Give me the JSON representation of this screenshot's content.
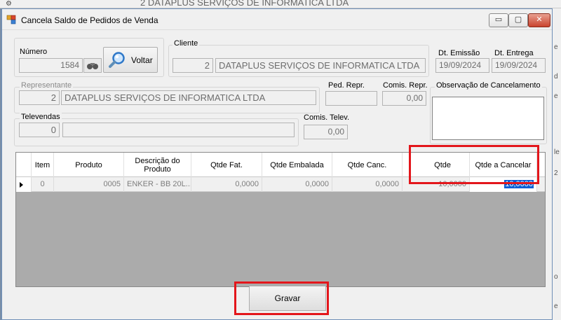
{
  "background": {
    "parent_text": "2  DATAPLUS SERVIÇOS DE INFORMATICA LTDA",
    "right_edge": [
      "e",
      "d",
      "e",
      "le",
      "2",
      "o",
      "e"
    ]
  },
  "window": {
    "title": "Cancela Saldo de Pedidos de Venda",
    "controls": {
      "minimize": "▭",
      "maximize": "▢",
      "close": "✕"
    }
  },
  "form": {
    "numero": {
      "label": "Número",
      "value": "1584"
    },
    "voltar_label": "Voltar",
    "cliente": {
      "label": "Cliente",
      "code": "2",
      "name": "DATAPLUS SERVIÇOS DE INFORMATICA LTDA"
    },
    "dt_emissao": {
      "label": "Dt. Emissão",
      "value": "19/09/2024"
    },
    "dt_entrega": {
      "label": "Dt. Entrega",
      "value": "19/09/2024"
    },
    "representante": {
      "label": "Representante",
      "code": "2",
      "name": "DATAPLUS SERVIÇOS DE INFORMATICA LTDA"
    },
    "ped_repr": {
      "label": "Ped. Repr.",
      "value": ""
    },
    "comis_repr": {
      "label": "Comis. Repr.",
      "value": "0,00"
    },
    "observacao": {
      "label": "Observação de Cancelamento",
      "value": ""
    },
    "televendas": {
      "label": "Televendas",
      "code": "0",
      "name": ""
    },
    "comis_telev": {
      "label": "Comis. Telev.",
      "value": "0,00"
    }
  },
  "grid": {
    "columns": [
      "Item",
      "Produto",
      "Descrição do Produto",
      "Qtde Fat.",
      "Qtde Embalada",
      "Qtde Canc.",
      "Qtde",
      "Qtde a Cancelar"
    ],
    "rows": [
      {
        "item": "0",
        "produto": "0005",
        "descricao": "ENKER - BB 20L...",
        "qtde_fat": "0,0000",
        "qtde_embalada": "0,0000",
        "qtde_canc": "0,0000",
        "qtde": "10,0000",
        "qtde_cancelar": "10,0000"
      }
    ]
  },
  "gravar_label": "Gravar",
  "colors": {
    "highlight": "#e3161b",
    "selection": "#0a5fd6"
  }
}
